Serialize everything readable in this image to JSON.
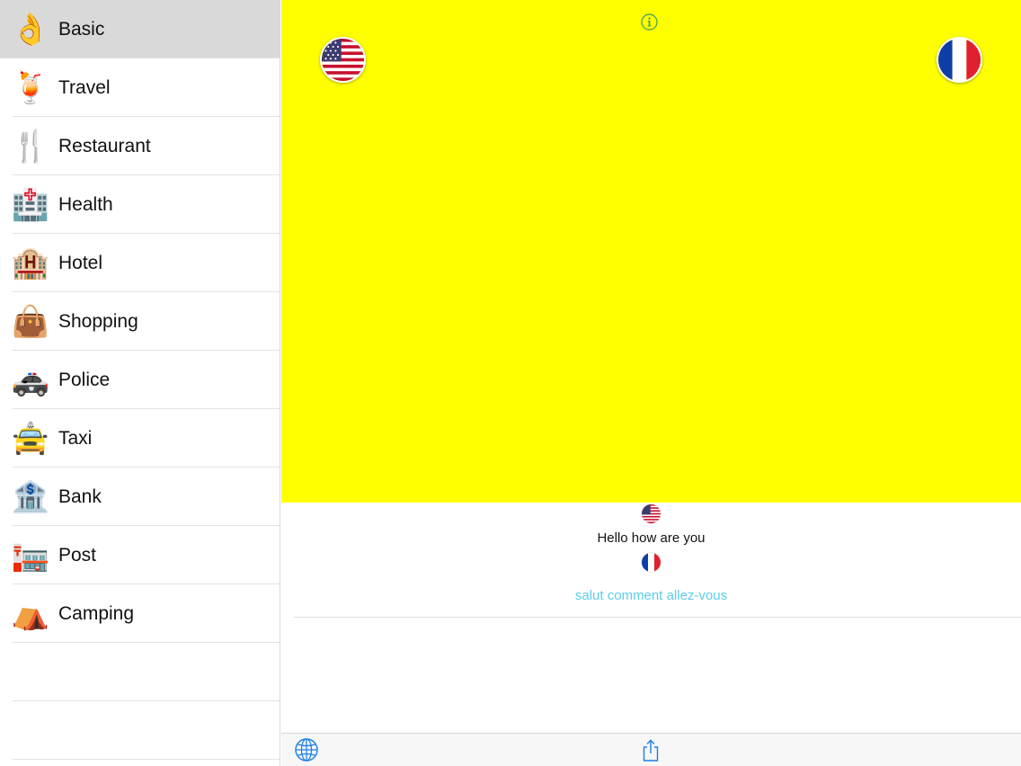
{
  "sidebar": {
    "items": [
      {
        "label": "Basic",
        "icon": "👌",
        "icon_name": "ok-hand-icon",
        "selected": true
      },
      {
        "label": "Travel",
        "icon": "🍹",
        "icon_name": "tropical-drink-icon"
      },
      {
        "label": "Restaurant",
        "icon": "🍴",
        "icon_name": "fork-knife-icon"
      },
      {
        "label": "Health",
        "icon": "🏥",
        "icon_name": "hospital-icon"
      },
      {
        "label": "Hotel",
        "icon": "🏨",
        "icon_name": "hotel-icon"
      },
      {
        "label": "Shopping",
        "icon": "👜",
        "icon_name": "handbag-icon"
      },
      {
        "label": "Police",
        "icon": "🚓",
        "icon_name": "police-car-icon"
      },
      {
        "label": "Taxi",
        "icon": "🚖",
        "icon_name": "taxi-icon"
      },
      {
        "label": "Bank",
        "icon": "🏦",
        "icon_name": "bank-icon"
      },
      {
        "label": "Post",
        "icon": "🏣",
        "icon_name": "post-office-icon"
      },
      {
        "label": "Camping",
        "icon": "⛺",
        "icon_name": "tent-icon"
      }
    ]
  },
  "main": {
    "panel_color": "#ffff00",
    "source_language_flag": "us-flag-icon",
    "target_language_flag": "france-flag-icon",
    "phrase": {
      "source": "Hello how are you",
      "target": "salut comment allez-vous"
    },
    "accent_color": "#5ccde8",
    "toolbar": {
      "left_icon": "globe-icon",
      "center_icon": "share-icon"
    }
  }
}
